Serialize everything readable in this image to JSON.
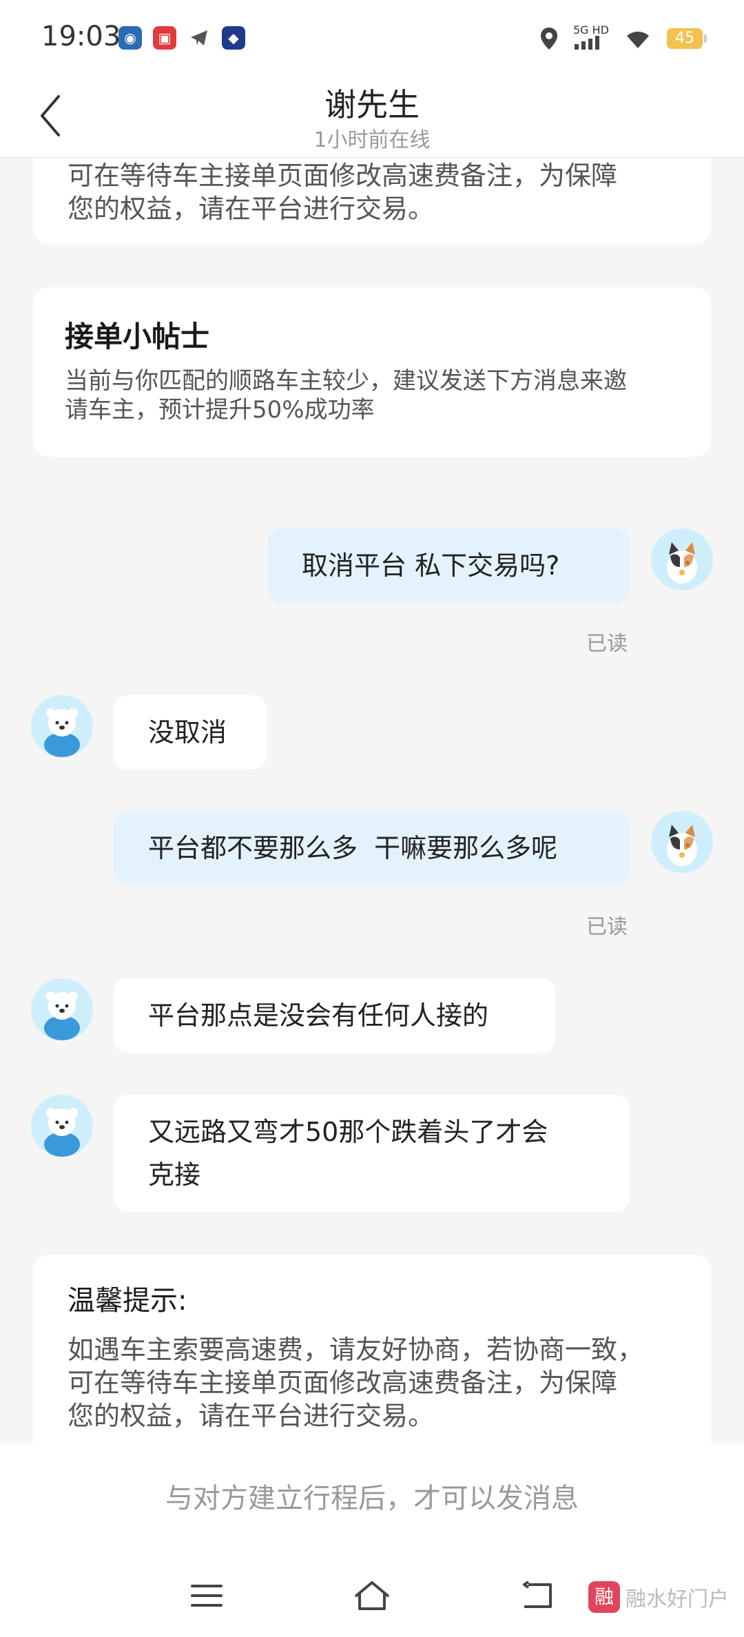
{
  "status_bar": {
    "time": "19:03",
    "network_label": "5G HD",
    "battery": "45"
  },
  "header": {
    "contact_name": "谢先生",
    "online_status": "1小时前在线"
  },
  "top_card": {
    "line1": "可在等待车主接单页面修改高速费备注，为保障",
    "line2": "您的权益，请在平台进行交易。"
  },
  "tips_card": {
    "title": "接单小帖士",
    "line1": "当前与你匹配的顺路车主较少，建议发送下方消息来邀",
    "line2": "请车主，预计提升50%成功率"
  },
  "messages": [
    {
      "from": "me",
      "text": "取消平台 私下交易吗?",
      "status": "已读"
    },
    {
      "from": "other",
      "text": "没取消"
    },
    {
      "from": "me",
      "text": "平台都不要那么多  干嘛要那么多呢",
      "status": "已读"
    },
    {
      "from": "other",
      "text": "平台那点是没会有任何人接的"
    },
    {
      "from": "other",
      "line1": "又远路又弯才50那个跌着头了才会",
      "line2": "克接"
    }
  ],
  "warm_tip": {
    "title": "温馨提示:",
    "line1": "如遇车主索要高速费，请友好协商，若协商一致，",
    "line2": "可在等待车主接单页面修改高速费备注，为保障",
    "line3": "您的权益，请在平台进行交易。"
  },
  "footer": {
    "notice": "与对方建立行程后，才可以发消息"
  },
  "watermark": {
    "logo": "融",
    "text": "融水好门户"
  },
  "colors": {
    "my_bubble": "#e4f2fd",
    "other_bubble": "#ffffff",
    "background": "#f5f5f5",
    "read_status": "#999999"
  }
}
